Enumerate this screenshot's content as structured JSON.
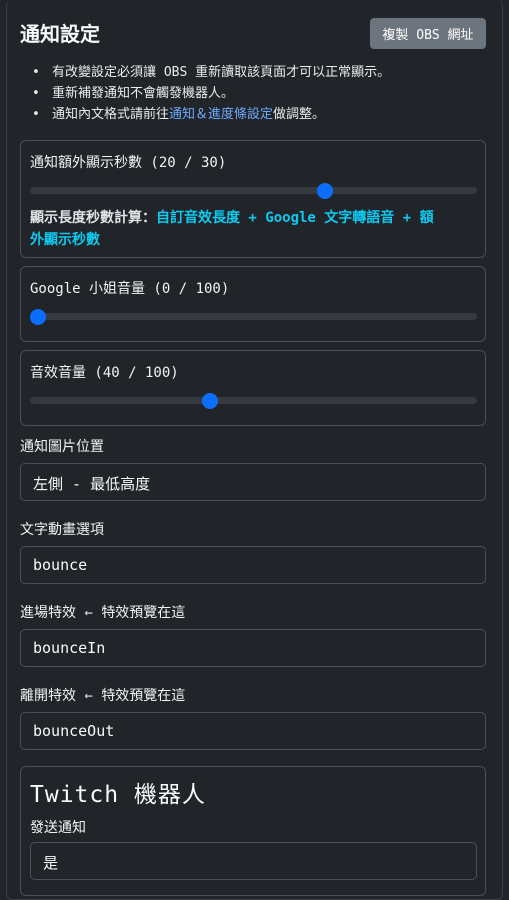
{
  "header": {
    "title": "通知設定",
    "copy_button": "複製 OBS 網址"
  },
  "notes": {
    "item1": "有改變設定必須讓 OBS 重新讀取該頁面才可以正常顯示。",
    "item2": "重新補發通知不會觸發機器人。",
    "item3_prefix": "通知內文格式請前往",
    "item3_link": "通知＆進度條設定",
    "item3_suffix": "做調整。"
  },
  "extra_seconds": {
    "label": "通知額外顯示秒數 (20 / 30)",
    "value": 20,
    "max": 30,
    "calc_prefix": "顯示長度秒數計算：",
    "calc_highlight1": "自訂音效長度 + Google 文字轉語音 + 額",
    "calc_highlight2": "外顯示秒數"
  },
  "google_volume": {
    "label": "Google 小姐音量 (0 / 100)",
    "value": 0,
    "max": 100
  },
  "sfx_volume": {
    "label": "音效音量 (40 / 100)",
    "value": 40,
    "max": 100
  },
  "image_position": {
    "label": "通知圖片位置",
    "value": "左側 - 最低高度"
  },
  "text_animation": {
    "label": "文字動畫選項",
    "value": "bounce"
  },
  "enter_effect": {
    "label": "進場特效",
    "arrow": "←",
    "preview": "特效預覽在這",
    "value": "bounceIn"
  },
  "exit_effect": {
    "label": "離開特效",
    "arrow": "←",
    "preview": "特效預覽在這",
    "value": "bounceOut"
  },
  "twitch": {
    "title": "Twitch 機器人",
    "send_label": "發送通知",
    "send_value": "是"
  },
  "colors": {
    "accent": "#0d6efd",
    "highlight": "#0dcaf0",
    "link": "#6ea8fe"
  }
}
